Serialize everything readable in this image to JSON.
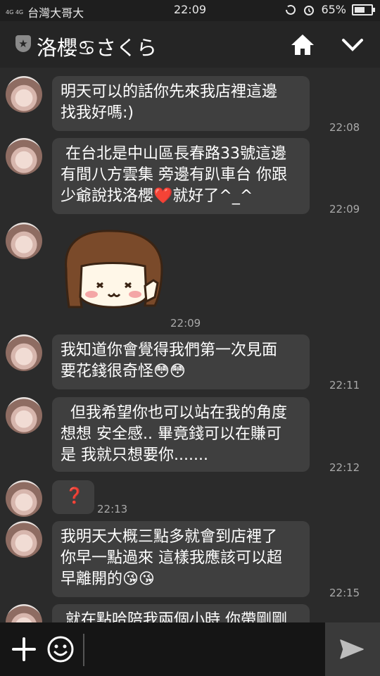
{
  "status_bar": {
    "network": "4G 4G",
    "carrier": "台灣大哥大",
    "time": "22:09",
    "battery_text": "65%",
    "battery_level": 0.65
  },
  "header": {
    "contact_name": "洛櫻♋さくら",
    "badge_icon": "star-shield-icon"
  },
  "messages": [
    {
      "text": "明天可以的話你先來我店裡這邊\n找我好嗎:)",
      "time": "22:08"
    },
    {
      "text": " 在台北是中山區長春路33號這邊\n有間八方雲集 旁邊有趴車台 你跟\n少爺說找洛櫻❤️就好了^_^",
      "time": "22:09"
    },
    {
      "sticker": "cartoon-girl-sticker",
      "time": "22:09"
    },
    {
      "text": "我知道你會覺得我們第一次見面\n要花錢很奇怪😳😳",
      "time": "22:11"
    },
    {
      "text": "  但我希望你也可以站在我的角度\n想想 安全感.. 畢竟錢可以在賺可\n是 我就只想要你.......",
      "time": "22:12"
    },
    {
      "text": "❓",
      "time": "22:13"
    },
    {
      "text": "我明天大概三點多就會到店裡了\n你早一點過來 這樣我應該可以超\n早離開的😘😘",
      "time": "22:15"
    },
    {
      "text": " 就在點哈陪我兩個小時 你帶剛剛",
      "time": ""
    }
  ],
  "input_bar": {
    "placeholder": "",
    "icons": [
      "plus-icon",
      "emoji-icon",
      "send-icon"
    ]
  },
  "colors": {
    "background": "#2b2b2b",
    "bubble": "#3f3f3f",
    "header": "#252525",
    "input_bar": "#151515"
  }
}
